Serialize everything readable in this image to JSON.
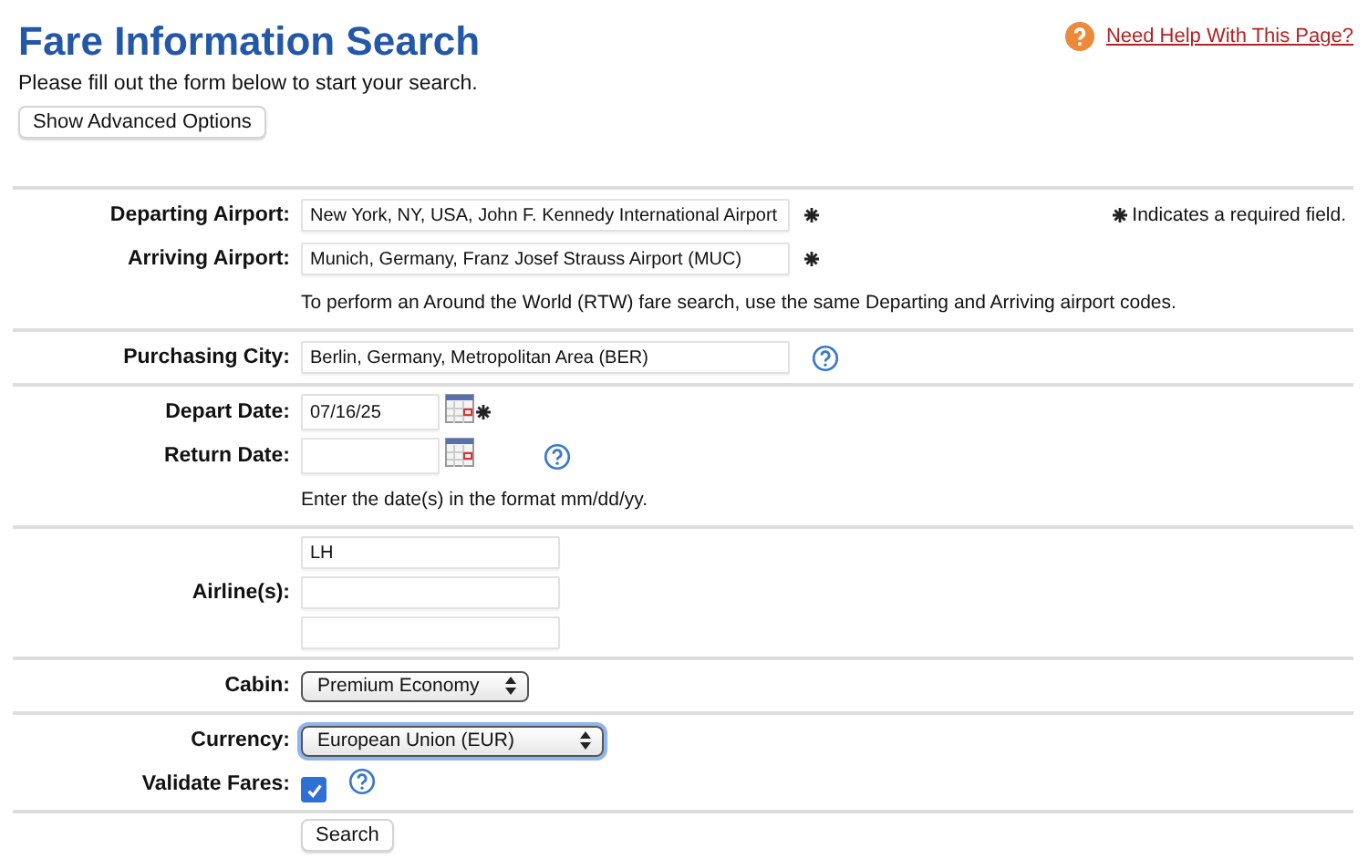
{
  "header": {
    "title": "Fare Information Search",
    "subtitle": "Please fill out the form below to start your search.",
    "advanced_button": "Show Advanced Options",
    "help_link": "Need Help With This Page?"
  },
  "required_legend": "Indicates a required field.",
  "sections": [
    {
      "rows": [
        {
          "kind": "text",
          "label": "Departing Airport:",
          "value": "New York, NY, USA, John F. Kennedy International Airport",
          "required": true,
          "help": false
        },
        {
          "kind": "text",
          "label": "Arriving Airport:",
          "value": "Munich, Germany, Franz Josef Strauss Airport (MUC)",
          "required": true,
          "help": false
        },
        {
          "kind": "note",
          "text": "To perform an Around the World (RTW) fare search, use the same Departing and Arriving airport codes."
        }
      ]
    },
    {
      "rows": [
        {
          "kind": "text",
          "label": "Purchasing City:",
          "value": "Berlin, Germany, Metropolitan Area (BER)",
          "required": false,
          "help": true
        }
      ]
    },
    {
      "rows": [
        {
          "kind": "date",
          "label": "Depart Date:",
          "value": "07/16/25",
          "required": true,
          "help": false
        },
        {
          "kind": "date",
          "label": "Return Date:",
          "required": false,
          "help": true
        },
        {
          "kind": "note",
          "text": "Enter the date(s) in the format mm/dd/yy."
        }
      ]
    },
    {
      "rows": [
        {
          "kind": "multi",
          "label": "Airline(s):",
          "values": [
            "LH"
          ]
        }
      ]
    },
    {
      "rows": [
        {
          "kind": "select",
          "label": "Cabin:",
          "value": "Premium Economy",
          "focused": false
        }
      ]
    },
    {
      "rows": [
        {
          "kind": "select",
          "label": "Currency:",
          "value": "European Union (EUR)",
          "focused": true
        },
        {
          "kind": "checkbox",
          "label": "Validate Fares:",
          "checked": true,
          "help": true
        }
      ]
    }
  ],
  "submit": "Search"
}
